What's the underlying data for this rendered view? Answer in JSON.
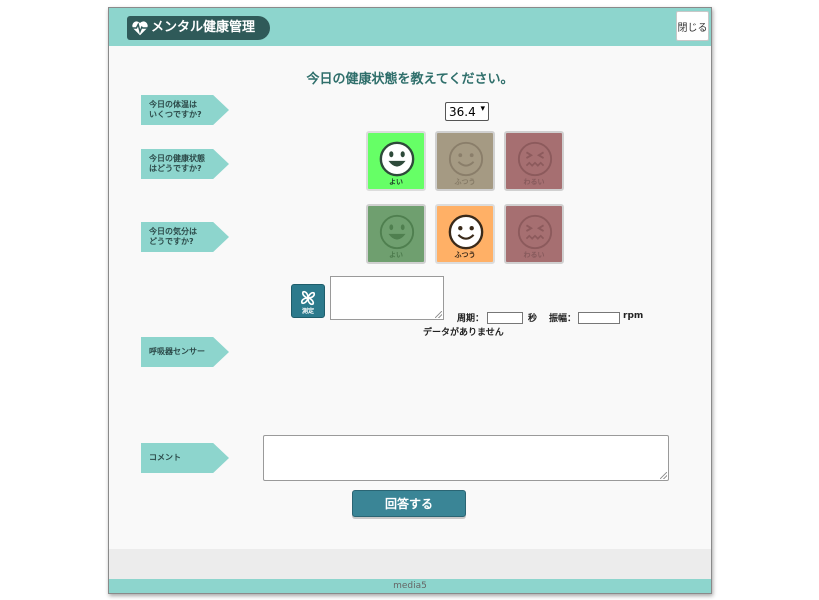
{
  "header": {
    "app_title": "メンタル健康管理",
    "close_label": "閉じる"
  },
  "main": {
    "page_title": "今日の健康状態を教えてください。",
    "labels": {
      "temperature": "今日の体温は\nいくつですか?",
      "health": "今日の健康状態\nはどうですか?",
      "mood": "今日の気分は\nどうですか?",
      "breath": "呼吸器センサー",
      "comment": "コメント"
    },
    "temperature_value": "36.4",
    "health_options": [
      {
        "label": "よい",
        "state": "selected"
      },
      {
        "label": "ふつう",
        "state": "dim"
      },
      {
        "label": "わるい",
        "state": "dim"
      }
    ],
    "mood_options": [
      {
        "label": "よい",
        "state": "dim"
      },
      {
        "label": "ふつう",
        "state": "selected"
      },
      {
        "label": "わるい",
        "state": "dim"
      }
    ],
    "breath": {
      "measure_label": "測定",
      "period_label": "周期：",
      "period_unit": "秒",
      "amplitude_label": "振幅：",
      "amplitude_unit": "rpm",
      "status": "データがありません"
    },
    "submit_label": "回答する"
  },
  "footer": {
    "text": "media5"
  },
  "colors": {
    "accent": "#8dd5cd",
    "logo_bg": "#2f5a59",
    "good_selected": "#66ff66",
    "good_dim": "#6f9f6f",
    "normal_selected": "#ffb066",
    "normal_dim": "#a59a83",
    "bad_dim": "#a66f71",
    "button": "#3a8596"
  }
}
